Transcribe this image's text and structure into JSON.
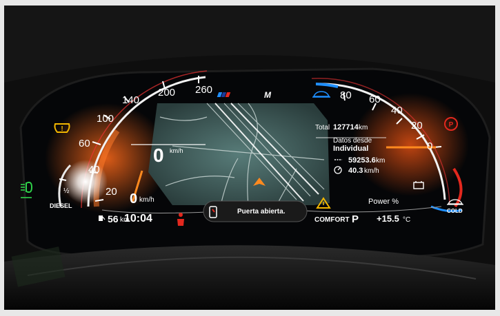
{
  "brand": {
    "logo_text": "M"
  },
  "speedometer": {
    "ticks": [
      "20",
      "40",
      "60",
      "100",
      "140",
      "200",
      "260"
    ],
    "speed_value": "0",
    "speed_unit": "km/h",
    "speed_scale_value": "0",
    "speed_scale_unit": "km/h"
  },
  "fuel": {
    "half_label": "½",
    "fuel_type": "DIESEL",
    "range_value": "56",
    "range_unit": "km"
  },
  "clock": {
    "time": "10:04"
  },
  "trip": {
    "total_label": "Total",
    "total_value": "127714",
    "total_unit": "km",
    "since_label": "Datos desde",
    "since_value": "Individual",
    "distance_value": "59253.6",
    "distance_unit": "km",
    "avg_speed_value": "40.3",
    "avg_speed_unit": "km/h"
  },
  "notification": {
    "text": "Puerta abierta."
  },
  "status": {
    "drive_mode": "COMFORT",
    "gear": "P",
    "temperature": "+15.5",
    "temperature_unit": "°C"
  },
  "power_meter": {
    "ticks": [
      "80",
      "60",
      "40",
      "20",
      "0"
    ],
    "label": "Power %",
    "charge_label": "COLD"
  },
  "icons": [
    "tire-pressure-warning-icon",
    "headlight-icon",
    "parking-brake-icon",
    "warning-triangle-icon",
    "seatbelt-warning-icon",
    "door-open-icon",
    "fuel-pump-icon",
    "battery-icon",
    "navigation-arrow-icon",
    "eco-car-icon"
  ],
  "colors": {
    "needle": "#ff8a1f",
    "warning_amber": "#f3b700",
    "warning_red": "#e3281e",
    "indicator_green": "#2fd34a",
    "eco_blue": "#1f8fff",
    "map_bg": "#4f7270"
  }
}
